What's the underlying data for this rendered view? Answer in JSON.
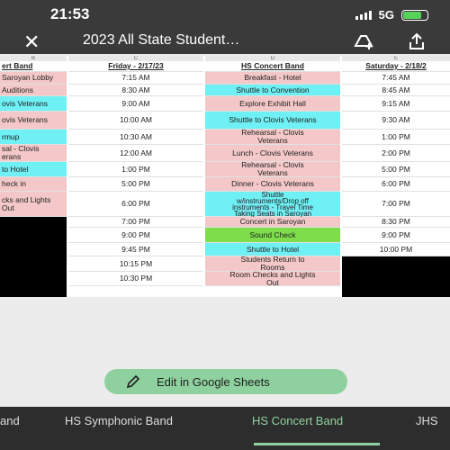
{
  "status": {
    "time": "21:53",
    "network": "5G"
  },
  "title": "2023 All State Student…",
  "columns": {
    "a_letter": "B",
    "c_letter": "C",
    "d_letter": "D",
    "e_letter": "E",
    "a_header": "ert Band",
    "c_header": "Friday - 2/17/23",
    "d_header": "HS Concert Band",
    "e_header": "Saturday - 2/18/2"
  },
  "colA": [
    "Saroyan Lobby",
    "Auditions",
    "ovis Veterans",
    "ovis Veterans",
    "rmup",
    "sal - Clovis\nerans",
    "to Hotel",
    "heck in",
    "cks and Lights\nOut"
  ],
  "colC": [
    "7:15 AM",
    "8:30 AM",
    "9:00 AM",
    "10:00 AM",
    "10:30 AM",
    "12:00 AM",
    "1:00 PM",
    "5:00 PM",
    "6:00 PM",
    "7:00 PM",
    "9:00 PM",
    "9:45 PM",
    "10:15 PM",
    "10:30 PM"
  ],
  "colD": [
    "Breakfast - Hotel",
    "Shuttle to Convention",
    "Explore Exhibit Hall",
    "Shuttle to Clovis Veterans",
    "Rehearsal - Clovis\nVeterans",
    "Lunch - Clovis Veterans",
    "Rehearsal - Clovis\nVeterans",
    "Dinner - Clovis Veterans",
    "Shuttle\nw/instruments/Drop off\ninstruments - Travel Time\nTaking Seats in Saroyan",
    "Concert in Saroyan",
    "Sound Check",
    "Shuttle to Hotel",
    "Students Return to\nRooms",
    "Room Checks and Lights\nOut"
  ],
  "colE": [
    "7:45 AM",
    "8:45 AM",
    "9:15 AM",
    "9:30 AM",
    "1:00 PM",
    "2:00 PM",
    "5:00 PM",
    "6:00 PM",
    "7:00 PM",
    "8:30 PM",
    "9:00 PM",
    "10:00 PM"
  ],
  "edit_button": "Edit in Google Sheets",
  "tabs": [
    "and",
    "HS Symphonic Band",
    "HS Concert Band",
    "JHS"
  ]
}
